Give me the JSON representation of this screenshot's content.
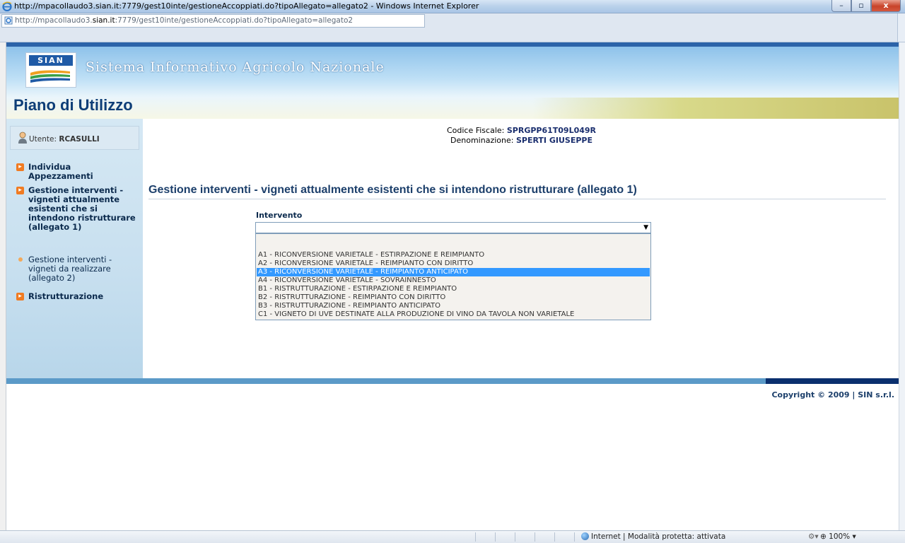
{
  "window": {
    "title": "http://mpacollaudo3.sian.it:7779/gest10inte/gestioneAccoppiati.do?tipoAllegato=allegato2 - Windows Internet Explorer",
    "controls": {
      "minimize": "–",
      "maximize": "▫",
      "close": "x"
    }
  },
  "address": {
    "url_prefix": "http://mpacollaudo3.",
    "url_domain": "sian.it",
    "url_suffix": ":7779/gest10inte/gestioneAccoppiati.do?tipoAllegato=allegato2"
  },
  "header": {
    "logo_text": "SIAN",
    "brand": "Sistema Informativo Agricolo Nazionale",
    "app_title": "Piano di Utilizzo"
  },
  "sidebar": {
    "user_label": "Utente:",
    "user_name": "RCASULLI",
    "items": [
      {
        "label": "Individua Appezzamenti",
        "style": "bold-orange"
      },
      {
        "label": "Gestione interventi - vigneti attualmente esistenti che si intendono ristrutturare (allegato 1)",
        "style": "bold-orange-active"
      },
      {
        "label": "Gestione interventi - vigneti da realizzare (allegato 2)",
        "style": "sub-dot"
      },
      {
        "label": "Ristrutturazione",
        "style": "bold-orange"
      }
    ]
  },
  "main": {
    "codice_fiscale_label": "Codice Fiscale:",
    "codice_fiscale_value": "SPRGPP61T09L049R",
    "denominazione_label": "Denominazione:",
    "denominazione_value": "SPERTI GIUSEPPE",
    "page_title": "Gestione interventi - vigneti attualmente esistenti che si intendono ristrutturare (allegato 1)",
    "intervento_label": "Intervento",
    "selected_value": "",
    "options": [
      "",
      "A1 - RICONVERSIONE VARIETALE - ESTIRPAZIONE E REIMPIANTO",
      "A2 - RICONVERSIONE VARIETALE - REIMPIANTO CON DIRITTO",
      "A3 - RICONVERSIONE VARIETALE - REIMPIANTO ANTICIPATO",
      "A4 - RICONVERSIONE VARIETALE - SOVRAINNESTO",
      "B1 - RISTRUTTURAZIONE - ESTIRPAZIONE E REIMPIANTO",
      "B2 - RISTRUTTURAZIONE - REIMPIANTO CON DIRITTO",
      "B3 - RISTRUTTURAZIONE - REIMPIANTO ANTICIPATO",
      "C1 - VIGNETO DI UVE DESTINATE ALLA PRODUZIONE DI VINO DA TAVOLA NON VARIETALE"
    ],
    "highlighted_option_index": 3
  },
  "footer": {
    "copyright": "Copyright © 2009 | SIN s.r.l."
  },
  "statusbar": {
    "zone": "Internet | Modalità protetta: attivata",
    "zoom": "100%"
  },
  "colors": {
    "header_bar": "#2c63a8",
    "title_text": "#0e3e77",
    "nav_icon": "#f07b22",
    "selection": "#3399ff",
    "footer_dark": "#0a2f6e"
  }
}
